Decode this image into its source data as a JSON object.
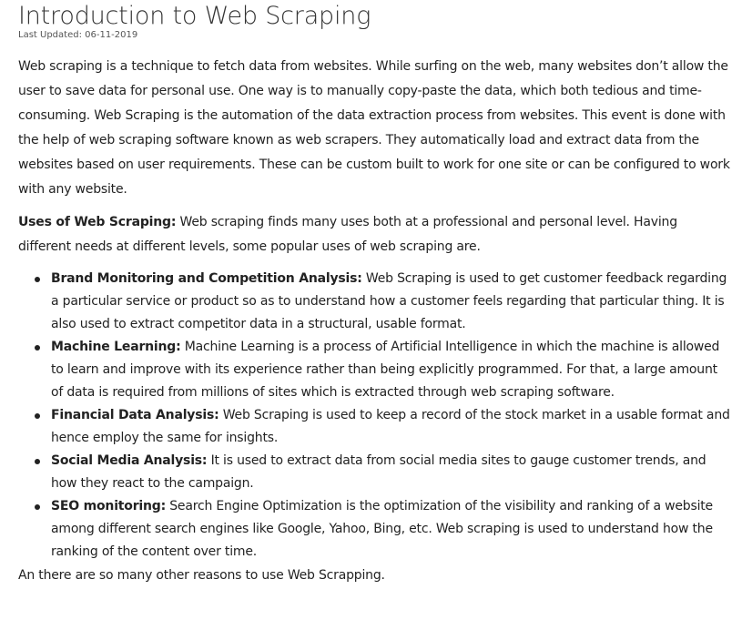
{
  "article": {
    "title": "Introduction to Web Scraping",
    "last_updated": "Last Updated: 06-11-2019",
    "intro": "Web scraping is a technique to fetch data from websites. While surfing on the web, many websites don’t allow the user to save data for personal use. One way is to manually copy-paste the data, which both tedious and time-consuming. Web Scraping is the automation of the data extraction process from websites. This event is done with the help of web scraping software known as web scrapers. They automatically load and extract data from the websites based on user requirements. These can be custom built to work for one site or can be configured to work with any website.",
    "uses_heading": "Uses of Web Scraping:",
    "uses_intro": " Web scraping finds many uses both at a professional and personal level. Having different needs at different levels, some popular uses of web scraping are.",
    "uses": [
      {
        "term": "Brand Monitoring and Competition Analysis:",
        "text": " Web Scraping is used to get customer feedback regarding a particular service or product so as to understand how a customer feels regarding that particular thing. It is also used to extract competitor data in a structural, usable format."
      },
      {
        "term": "Machine Learning:",
        "text": " Machine Learning is a process of Artificial Intelligence in which the machine is allowed to learn and improve with its experience rather than being explicitly programmed. For that, a large amount of data is required from millions of sites which is extracted through web scraping software."
      },
      {
        "term": "Financial Data Analysis:",
        "text": " Web Scraping is used to keep a record of the stock market in a usable format and hence employ the same for insights."
      },
      {
        "term": "Social Media Analysis:",
        "text": " It is used to extract data from social media sites to gauge customer trends, and how they react to the campaign."
      },
      {
        "term": "SEO monitoring:",
        "text": " Search Engine Optimization is the optimization of the visibility and ranking of a website among different search engines like Google, Yahoo, Bing, etc. Web scraping is used to understand how the ranking of the content over time."
      }
    ],
    "closing": "An there are so many other reasons to use Web Scrapping."
  }
}
